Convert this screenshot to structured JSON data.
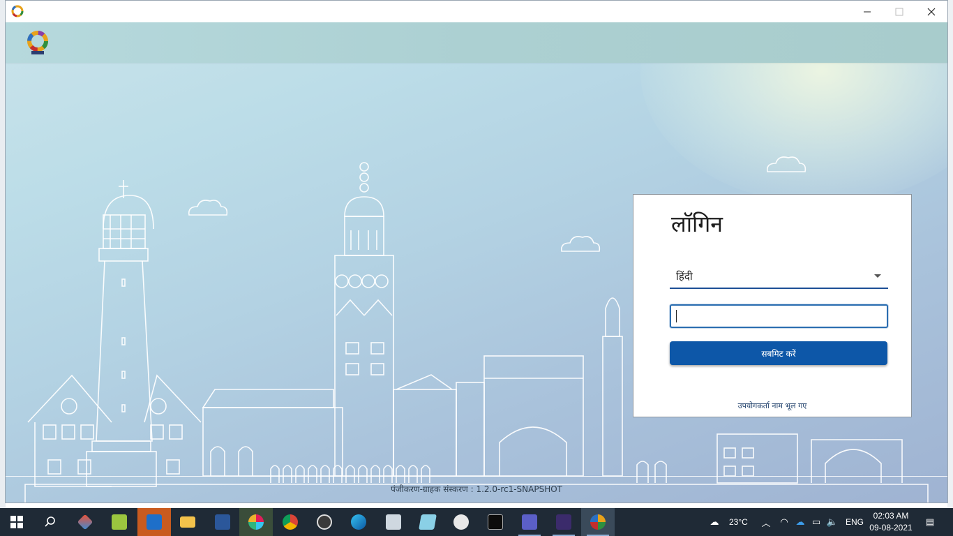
{
  "window": {
    "title": ""
  },
  "login": {
    "title": "लॉगिन",
    "language_selected": "हिंदी",
    "username_value": "",
    "submit_label": "सबमिट करें",
    "forgot_username_label": "उपयोगकर्ता नाम भूल गए"
  },
  "footer": {
    "version_text": "पंजीकरण-ग्राहक संस्करण : 1.2.0-rc1-SNAPSHOT"
  },
  "taskbar": {
    "apps": [
      {
        "name": "start-button",
        "icon": "windows-logo-icon"
      },
      {
        "name": "search-button",
        "icon": "search-icon"
      },
      {
        "name": "taskbar-git",
        "icon": "git-icon"
      },
      {
        "name": "taskbar-notepadpp",
        "icon": "notepad-plus-plus-icon"
      },
      {
        "name": "taskbar-outlook",
        "icon": "outlook-icon"
      },
      {
        "name": "taskbar-file-explorer",
        "icon": "folder-icon"
      },
      {
        "name": "taskbar-word",
        "icon": "word-icon"
      },
      {
        "name": "taskbar-slack",
        "icon": "slack-icon"
      },
      {
        "name": "taskbar-chrome",
        "icon": "chrome-icon"
      },
      {
        "name": "taskbar-obs",
        "icon": "obs-icon"
      },
      {
        "name": "taskbar-edge",
        "icon": "edge-icon"
      },
      {
        "name": "taskbar-task-manager",
        "icon": "monitor-icon"
      },
      {
        "name": "taskbar-notes",
        "icon": "notes-icon"
      },
      {
        "name": "taskbar-snipping",
        "icon": "snipping-icon"
      },
      {
        "name": "taskbar-terminal",
        "icon": "terminal-icon"
      },
      {
        "name": "taskbar-teams",
        "icon": "teams-icon"
      },
      {
        "name": "taskbar-ide",
        "icon": "ide-icon"
      },
      {
        "name": "taskbar-registration-client",
        "icon": "mosip-logo-icon"
      }
    ],
    "weather": "23°C",
    "language": "ENG",
    "time": "02:03 AM",
    "date": "09-08-2021"
  },
  "colors": {
    "primary_blue": "#0d57a8",
    "header_teal": "#acd0d2",
    "taskbar_bg": "#1f2a36"
  }
}
